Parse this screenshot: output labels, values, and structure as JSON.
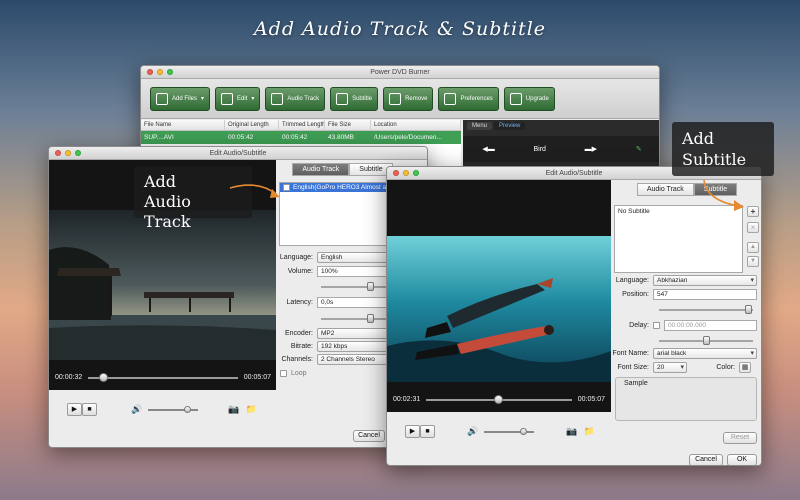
{
  "hero": {
    "title": "Add Audio Track & Subtitle"
  },
  "main_window": {
    "title": "Power DVD Burner",
    "toolbar": [
      {
        "label": "Add Files",
        "caret": "▾",
        "icon": "add-files-icon"
      },
      {
        "label": "Edit",
        "caret": "▾",
        "icon": "edit-icon"
      },
      {
        "label": "Audio Track",
        "caret": "",
        "icon": "audio-track-icon"
      },
      {
        "label": "Subtitle",
        "caret": "",
        "icon": "subtitle-icon"
      },
      {
        "label": "Remove",
        "caret": "",
        "icon": "remove-icon"
      },
      {
        "label": "Preferences",
        "caret": "",
        "icon": "preferences-icon"
      },
      {
        "label": "Upgrade",
        "caret": "",
        "icon": "upgrade-icon"
      }
    ],
    "columns": [
      "File Name",
      "Original Length",
      "Trimmed Length",
      "File Size",
      "Location"
    ],
    "rows": [
      {
        "name": "SUP....AVI",
        "original": "00:05:42",
        "trimmed": "00:05:42",
        "size": "43.80MB",
        "location": "/Users/pele/Documen..."
      }
    ],
    "preview": {
      "tabs": [
        "Menu",
        "Preview"
      ],
      "active_tab": "Preview",
      "title": "Bird"
    }
  },
  "audio_dialog": {
    "title": "Edit Audio/Subtitle",
    "tabs": [
      "Audio Track",
      "Subtitle"
    ],
    "active_tab": "Audio Track",
    "track_item": "English(GoPro HERO3 Almost as",
    "time_current": "00:00:32",
    "time_total": "00:05:07",
    "progress": 0.1,
    "language_label": "Language:",
    "language": "English",
    "volume_label": "Volume:",
    "volume": "100%",
    "latency_label": "Latency:",
    "latency": "0,0s",
    "encoder_label": "Encoder:",
    "encoder": "MP2",
    "bitrate_label": "Bitrate:",
    "bitrate": "192 kbps",
    "channels_label": "Channels:",
    "channels": "2 Channels Stereo",
    "loop_label": "Loop",
    "cancel_label": "Cancel",
    "callout": "Add\nAudio Track"
  },
  "subtitle_dialog": {
    "title": "Edit Audio/Subtitle",
    "tabs": [
      "Audio Track",
      "Subtitle"
    ],
    "active_tab": "Subtitle",
    "list_item": "No Subtitle",
    "time_current": "00:02:31",
    "time_total": "00:05:07",
    "progress": 0.49,
    "language_label": "Language:",
    "language": "Abkhazian",
    "position_label": "Position:",
    "position": "547",
    "delay_label": "Delay:",
    "delay": "00:00:00.000",
    "font_name_label": "Font Name:",
    "font_name": "arial black",
    "font_size_label": "Font Size:",
    "font_size": "20",
    "color_label": "Color:",
    "sample_label": "Sample",
    "reset_label": "Reset",
    "cancel_label": "Cancel",
    "ok_label": "OK",
    "callout": "Add\nSubtitle"
  },
  "colors": {
    "toolbar_green": "#2f6a33",
    "selection_blue": "#3a74d7",
    "row_green": "#3f9f55"
  }
}
